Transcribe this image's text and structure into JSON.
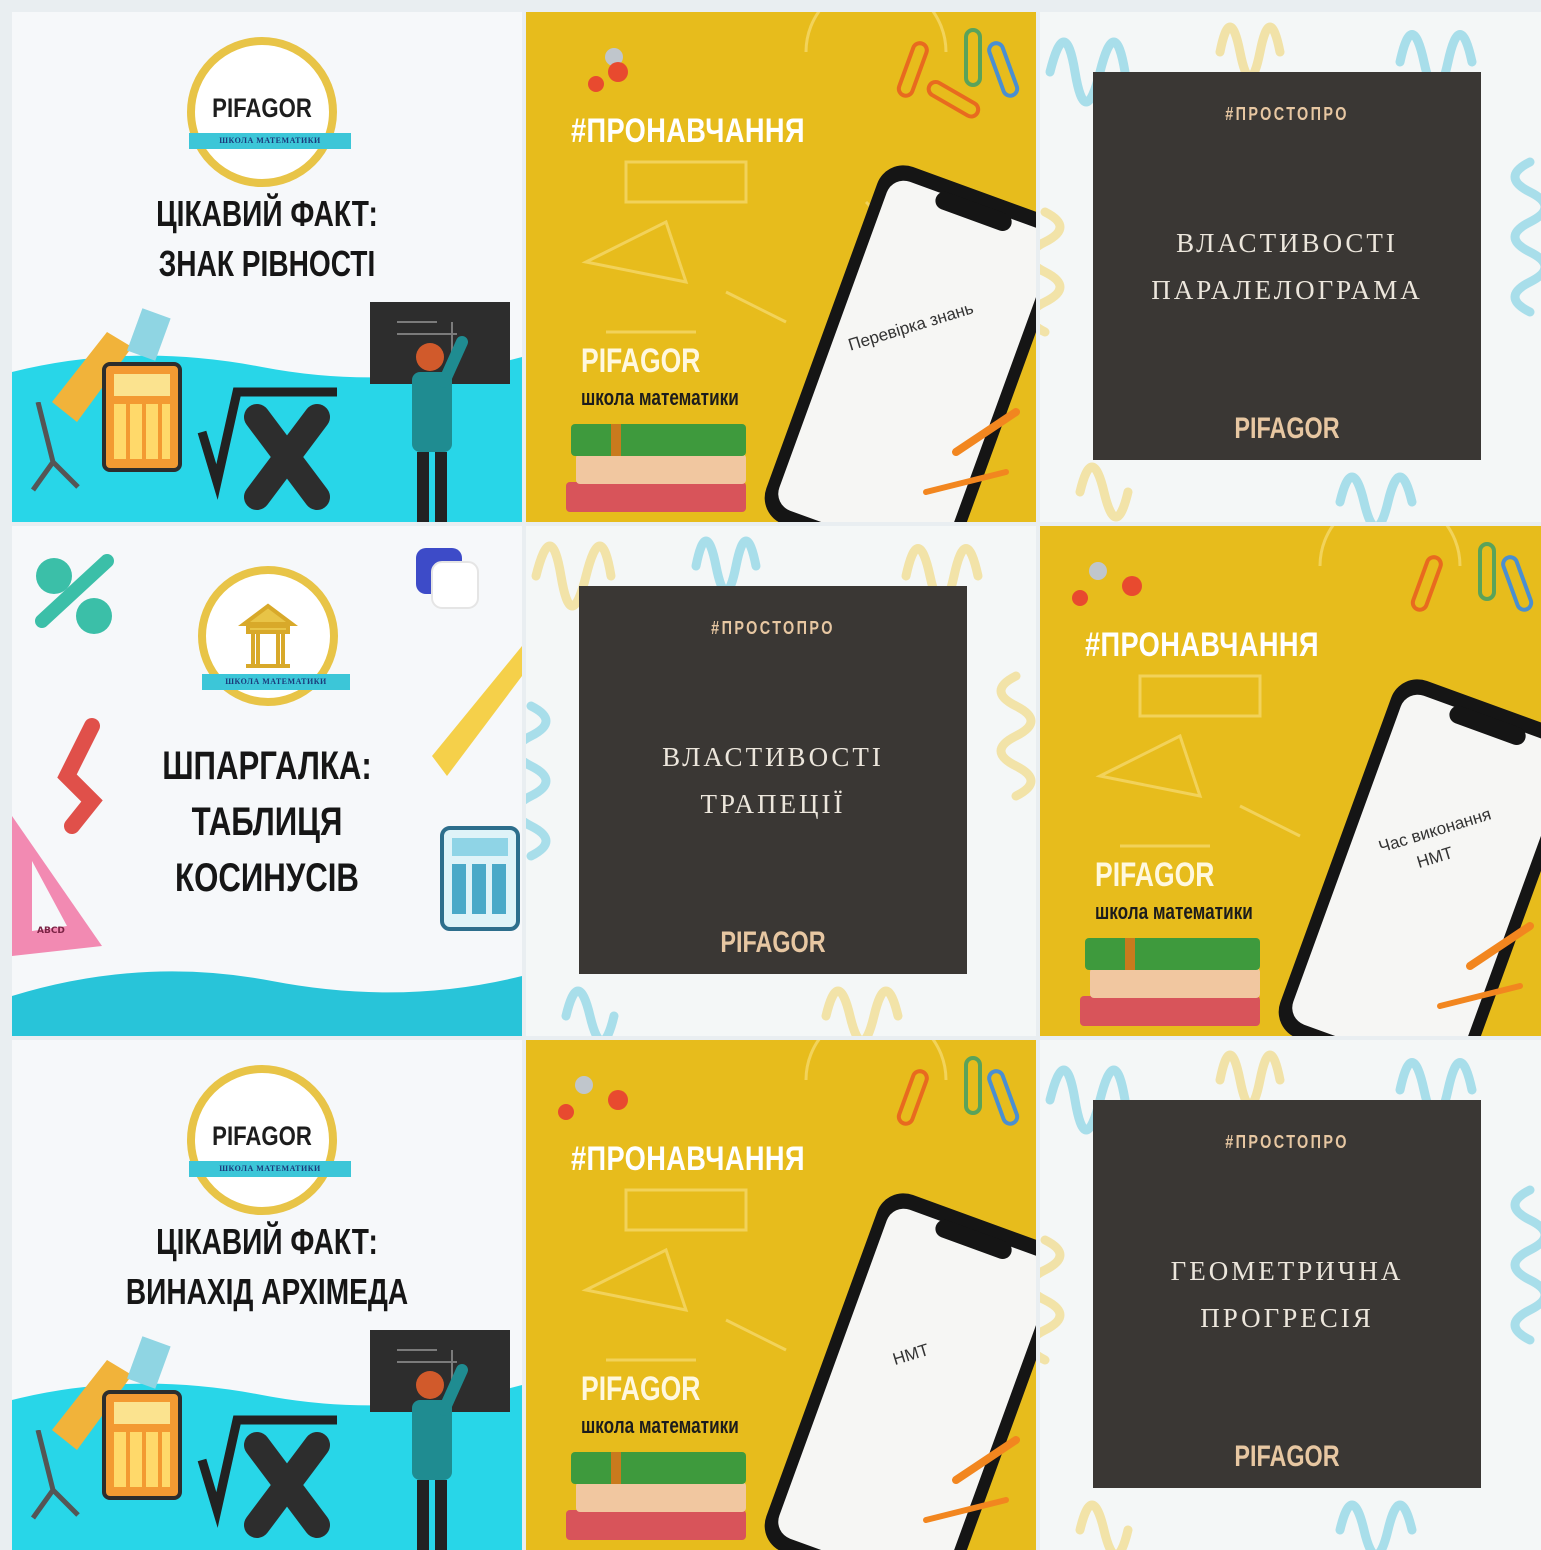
{
  "tiles": [
    {
      "kind": "white-fact",
      "badge_word": "PIFAGOR",
      "badge_ribbon": "ШКОЛА МАТЕМАТИКИ",
      "line1": "ЦІКАВИЙ ФАКТ:",
      "line2": "ЗНАК РІВНОСТІ"
    },
    {
      "kind": "yellow",
      "hashtag": "#ПРОНАВЧАННЯ",
      "brand": "PIFAGOR",
      "brand_sub": "школа математики",
      "phone_text": "Перевірка знань"
    },
    {
      "kind": "board",
      "tag": "#ПРОСТОПРО",
      "title1": "ВЛАСТИВОСТІ",
      "title2": "ПАРАЛЕЛОГРАМА",
      "sign": "PIFAGOR"
    },
    {
      "kind": "white-cheat",
      "badge_ribbon": "ШКОЛА МАТЕМАТИКИ",
      "line1": "ШПАРГАЛКА:",
      "line2": "ТАБЛИЦЯ",
      "line3": "КОСИНУСІВ",
      "triangle_label": "ABCD"
    },
    {
      "kind": "board",
      "tag": "#ПРОСТОПРО",
      "title1": "ВЛАСТИВОСТІ",
      "title2": "ТРАПЕЦІЇ",
      "sign": "PIFAGOR"
    },
    {
      "kind": "yellow",
      "hashtag": "#ПРОНАВЧАННЯ",
      "brand": "PIFAGOR",
      "brand_sub": "школа математики",
      "phone_text": "Час виконання",
      "phone_text2": "НМТ"
    },
    {
      "kind": "white-fact",
      "badge_word": "PIFAGOR",
      "badge_ribbon": "ШКОЛА МАТЕМАТИКИ",
      "line1": "ЦІКАВИЙ ФАКТ:",
      "line2": "ВИНАХІД АРХІМЕДА"
    },
    {
      "kind": "yellow",
      "hashtag": "#ПРОНАВЧАННЯ",
      "brand": "PIFAGOR",
      "brand_sub": "школа математики",
      "phone_text": "НМТ"
    },
    {
      "kind": "board",
      "tag": "#ПРОСТОПРО",
      "title1": "ГЕОМЕТРИЧНА",
      "title2": "ПРОГРЕСІЯ",
      "sign": "PIFAGOR"
    }
  ],
  "colors": {
    "yellow": "#e7bc1c",
    "cyan": "#3cc6d8",
    "dark": "#3a3734",
    "gold": "#e7c7a2"
  },
  "icons": [
    "multiple-images-icon",
    "calculator-icon",
    "ruler-icon",
    "compass-icon",
    "pushpin-icon",
    "paperclip-icon",
    "book-icon",
    "pencil-icon",
    "phone-icon"
  ]
}
